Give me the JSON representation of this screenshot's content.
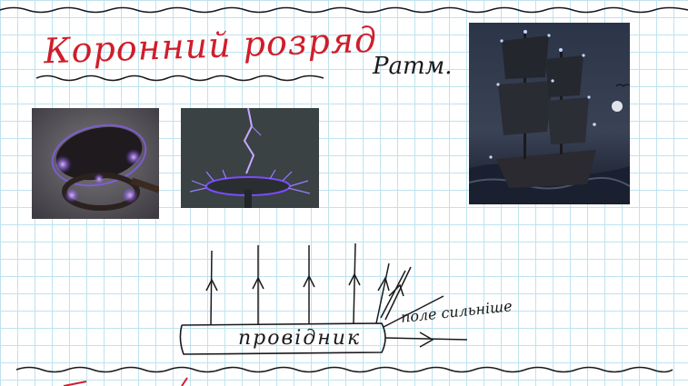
{
  "page": {
    "title": "Коронний розряд",
    "note": "Ратм.",
    "diagram": {
      "conductor_label": "провідник",
      "field_label": "поле сильніше"
    }
  },
  "colors": {
    "title_ink": "#d01d2a",
    "ink": "#1a1a1a",
    "grid": "#bfe3ef",
    "corona_glow": "#8a5cff"
  }
}
